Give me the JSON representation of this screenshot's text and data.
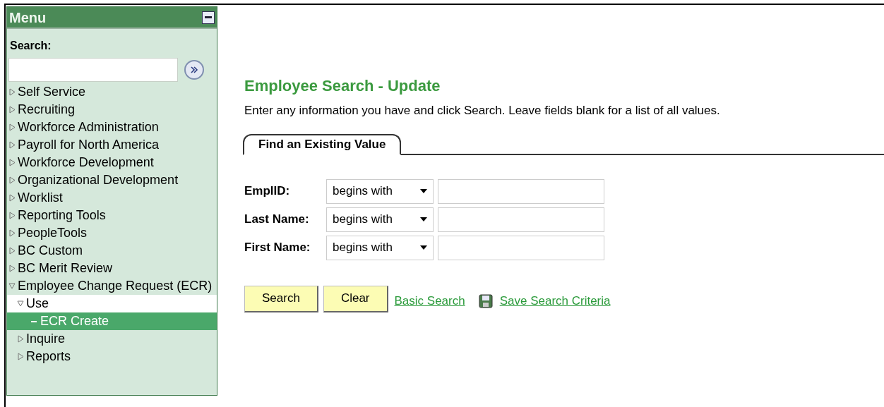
{
  "menu": {
    "title": "Menu",
    "search_label": "Search:",
    "items": [
      {
        "label": "Self Service",
        "kind": "folder",
        "expanded": false,
        "selected": false
      },
      {
        "label": "Recruiting",
        "kind": "folder",
        "expanded": false,
        "selected": false
      },
      {
        "label": "Workforce Administration",
        "kind": "folder",
        "expanded": false,
        "selected": false
      },
      {
        "label": "Payroll for North America",
        "kind": "folder",
        "expanded": false,
        "selected": false
      },
      {
        "label": "Workforce Development",
        "kind": "folder",
        "expanded": false,
        "selected": false
      },
      {
        "label": "Organizational Development",
        "kind": "folder",
        "expanded": false,
        "selected": false
      },
      {
        "label": "Worklist",
        "kind": "folder",
        "expanded": false,
        "selected": false
      },
      {
        "label": "Reporting Tools",
        "kind": "folder",
        "expanded": false,
        "selected": false
      },
      {
        "label": "PeopleTools",
        "kind": "folder",
        "expanded": false,
        "selected": false
      },
      {
        "label": "BC Custom",
        "kind": "folder",
        "expanded": false,
        "selected": false
      },
      {
        "label": "BC Merit Review",
        "kind": "folder",
        "expanded": false,
        "selected": false
      },
      {
        "label": "Employee Change Request (ECR)",
        "kind": "folder",
        "expanded": true,
        "selected": false,
        "children": [
          {
            "label": "Use",
            "kind": "folder",
            "expanded": true,
            "selected": false,
            "highlighted": true,
            "children": [
              {
                "label": "ECR Create",
                "kind": "page",
                "selected": true
              }
            ]
          },
          {
            "label": "Inquire",
            "kind": "folder",
            "expanded": false,
            "selected": false
          },
          {
            "label": "Reports",
            "kind": "folder",
            "expanded": false,
            "selected": false
          }
        ]
      }
    ]
  },
  "page": {
    "title": "Employee Search - Update",
    "instructions": "Enter any information you have and click Search. Leave fields blank for a list of all values.",
    "tabs": [
      {
        "label": "Find an Existing Value",
        "selected": true
      }
    ],
    "fields": [
      {
        "label": "EmplID:",
        "operator": "begins with"
      },
      {
        "label": "Last Name:",
        "operator": "begins with"
      },
      {
        "label": "First Name:",
        "operator": "begins with"
      }
    ],
    "buttons": [
      "Search",
      "Clear"
    ],
    "links": [
      "Basic Search",
      "Save Search Criteria"
    ]
  }
}
